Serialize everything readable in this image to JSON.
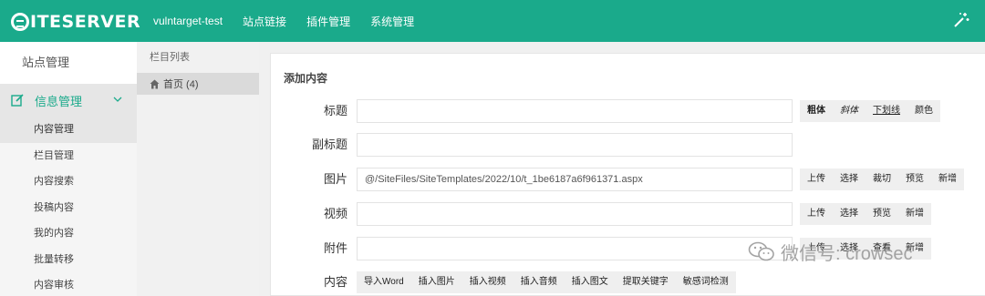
{
  "header": {
    "logo_text": "ITESERVER",
    "nav": [
      "vulntarget-test",
      "站点链接",
      "插件管理",
      "系统管理"
    ]
  },
  "sidebar": {
    "heading": "站点管理",
    "group_label": "信息管理",
    "items": [
      {
        "label": "内容管理",
        "active": true
      },
      {
        "label": "栏目管理",
        "active": false
      },
      {
        "label": "内容搜索",
        "active": false
      },
      {
        "label": "投稿内容",
        "active": false
      },
      {
        "label": "我的内容",
        "active": false
      },
      {
        "label": "批量转移",
        "active": false
      },
      {
        "label": "内容审核",
        "active": false
      }
    ]
  },
  "column_panel": {
    "title": "栏目列表",
    "node_label": "首页 (4)"
  },
  "form": {
    "title": "添加内容",
    "title_label": "标题",
    "title_value": "",
    "title_buttons": [
      "粗体",
      "斜体",
      "下划线",
      "颜色"
    ],
    "subtitle_label": "副标题",
    "subtitle_value": "",
    "image_label": "图片",
    "image_value": "@/SiteFiles/SiteTemplates/2022/10/t_1be6187a6f961371.aspx",
    "image_buttons": [
      "上传",
      "选择",
      "裁切",
      "预览",
      "新增"
    ],
    "video_label": "视频",
    "video_value": "",
    "video_buttons": [
      "上传",
      "选择",
      "预览",
      "新增"
    ],
    "attachment_label": "附件",
    "attachment_value": "",
    "attachment_buttons": [
      "上传",
      "选择",
      "查看",
      "新增"
    ],
    "content_label": "内容",
    "content_buttons": [
      "导入Word",
      "插入图片",
      "插入视频",
      "插入音频",
      "插入图文",
      "提取关键字",
      "敏感词检测"
    ]
  },
  "watermark": {
    "text": "微信号: crowsec"
  },
  "colors": {
    "brand": "#1aaa8b",
    "sidebar_active": "#e6e6e6",
    "button_bg": "#efefef"
  }
}
